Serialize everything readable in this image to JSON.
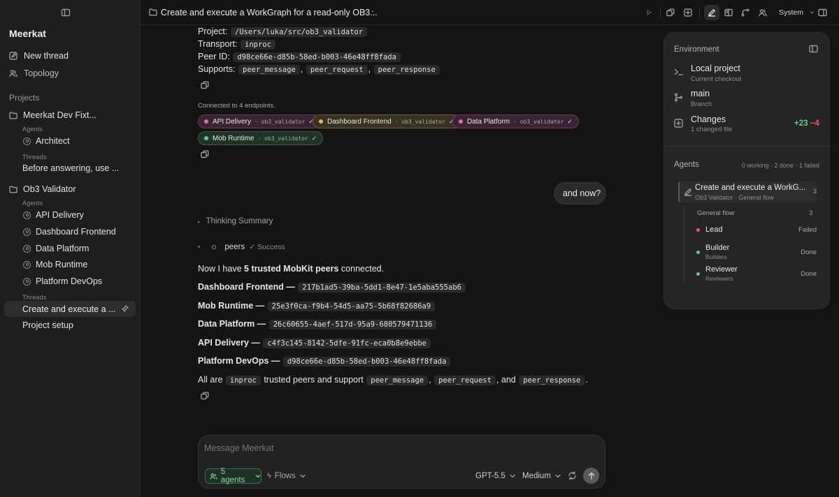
{
  "app": {
    "name": "Meerkat"
  },
  "sidebar": {
    "nav": [
      {
        "label": "New thread",
        "icon": "compose-icon"
      },
      {
        "label": "Topology",
        "icon": "users-icon"
      }
    ],
    "projects_heading": "Projects",
    "projects": [
      {
        "name": "Meerkat Dev Fixt...",
        "agents_heading": "Agents",
        "agents": [
          "Architect"
        ],
        "threads_heading": "Threads",
        "threads": [
          "Before answering, use ..."
        ]
      },
      {
        "name": "Ob3 Validator",
        "agents_heading": "Agents",
        "agents": [
          "API Delivery",
          "Dashboard Frontend",
          "Data Platform",
          "Mob Runtime",
          "Platform DevOps"
        ],
        "threads_heading": "Threads",
        "threads": [
          "Create and execute a ...",
          "Project setup"
        ]
      }
    ]
  },
  "topbar": {
    "title": "Create and execute a WorkGraph for a read-only OB3...",
    "more": "···",
    "theme": "System"
  },
  "chat": {
    "info": [
      {
        "label": "Project:",
        "code": "/Users/luka/src/ob3_validator"
      },
      {
        "label": "Transport:",
        "code": "inproc"
      },
      {
        "label": "Peer ID:",
        "code": "d98ce66e-d85b-58ed-b003-46e48ff8fada"
      }
    ],
    "supports_label": "Supports:",
    "supports": [
      "peer_message",
      "peer_request",
      "peer_response"
    ],
    "connected_text": "Connected to 4 endpoints.",
    "endpoints": [
      {
        "name": "API Delivery",
        "sub": "ob3_validator",
        "check": "✓",
        "dot": "#e06bb5",
        "bg": "#3a2433",
        "border": "#6a3a5a"
      },
      {
        "name": "Dashboard Frontend",
        "sub": "ob3_validator",
        "check": "✓",
        "dot": "#e8b659",
        "bg": "#3a3120",
        "border": "#6c5a30"
      },
      {
        "name": "Data Platform",
        "sub": "ob3_validator",
        "check": "✓",
        "dot": "#e06bb5",
        "bg": "#3a2433",
        "border": "#6a3a5a"
      },
      {
        "name": "Mob Runtime",
        "sub": "ob3_validator",
        "check": "✓",
        "dot": "#5fd08a",
        "bg": "#1f3327",
        "border": "#355c42"
      }
    ],
    "user_message": "and now?",
    "thinking": "Thinking Summary",
    "tool": {
      "name": "peers",
      "status": "✓ Success"
    },
    "summary_pre": "Now I have ",
    "summary_bold": "5 trusted MobKit peers",
    "summary_post": " connected.",
    "peers": [
      {
        "name": "Dashboard Frontend —",
        "id": "217b1ad5-39ba-5dd1-8e47-1e5aba555ab6"
      },
      {
        "name": "Mob Runtime —",
        "id": "25e3f0ca-f9b4-54d5-aa75-5b68f82686a9"
      },
      {
        "name": "Data Platform —",
        "id": "26c60655-4aef-517d-95a9-680579471136"
      },
      {
        "name": "API Delivery —",
        "id": "c4f3c145-8142-5dfe-91fc-eca0b8e9ebbe"
      },
      {
        "name": "Platform DevOps —",
        "id": "d98ce66e-d85b-58ed-b003-46e48ff8fada"
      }
    ],
    "final": {
      "t1": "All are ",
      "c1": "inproc",
      "t2": " trusted peers and support ",
      "c2": "peer_message",
      "t3": ", ",
      "c3": "peer_request",
      "t4": ", and ",
      "c4": "peer_response",
      "t5": "."
    }
  },
  "composer": {
    "placeholder": "Message Meerkat",
    "agents_btn": "5 agents",
    "flows_btn": "Flows",
    "model": "GPT-5.5",
    "effort": "Medium"
  },
  "panel": {
    "env_heading": "Environment",
    "env": [
      {
        "title": "Local project",
        "sub": "Current checkout",
        "icon": "terminal-icon"
      },
      {
        "title": "main",
        "sub": "Branch",
        "icon": "branch-icon"
      },
      {
        "title": "Changes",
        "sub": "1 changed file",
        "icon": "diff-icon",
        "added": "+23",
        "removed": "−4"
      }
    ],
    "agents_heading": "Agents",
    "agents_summary": "0 working · 2 done · 1 failed",
    "flow_item": {
      "title": "Create and execute a WorkG...",
      "sub": "Ob3 Validator · General flow",
      "count": "3"
    },
    "flow_group": {
      "label": "General flow",
      "count": "3"
    },
    "members": [
      {
        "name": "Lead",
        "role": "",
        "status": "Failed",
        "color": "#e0607a"
      },
      {
        "name": "Builder",
        "role": "Builders",
        "status": "Done",
        "color": "#5fd08a"
      },
      {
        "name": "Reviewer",
        "role": "Reviewers",
        "status": "Done",
        "color": "#5fd08a"
      }
    ],
    "colors": {
      "added": "#5fd08a",
      "removed": "#ef5b5b"
    }
  }
}
